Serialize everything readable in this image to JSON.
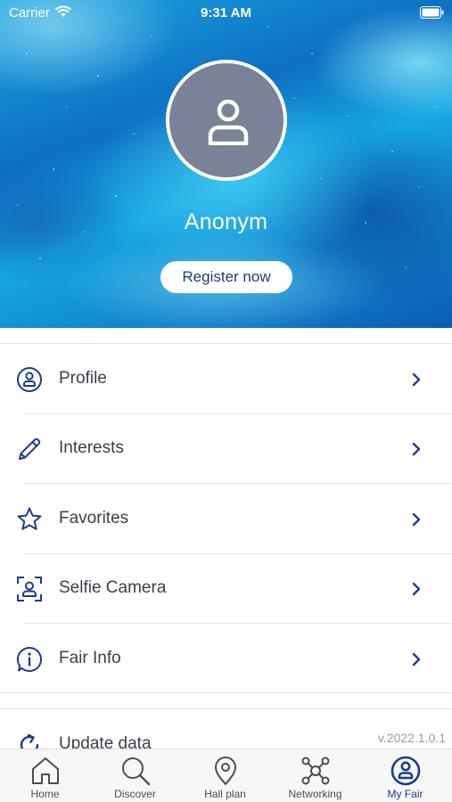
{
  "status_bar": {
    "carrier": "Carrier",
    "time": "9:31 AM"
  },
  "profile": {
    "name": "Anonym",
    "register_label": "Register now"
  },
  "menu": {
    "items": [
      {
        "label": "Profile",
        "icon": "user-circle-icon"
      },
      {
        "label": "Interests",
        "icon": "pencil-icon"
      },
      {
        "label": "Favorites",
        "icon": "star-icon"
      },
      {
        "label": "Selfie Camera",
        "icon": "selfie-camera-icon"
      },
      {
        "label": "Fair Info",
        "icon": "info-icon"
      }
    ],
    "update_label": "Update data",
    "version": "v.2022.1.0.1"
  },
  "tab_bar": {
    "tabs": [
      {
        "label": "Home",
        "icon": "home-icon"
      },
      {
        "label": "Discover",
        "icon": "search-icon"
      },
      {
        "label": "Hall plan",
        "icon": "map-pin-icon"
      },
      {
        "label": "Networking",
        "icon": "network-icon"
      },
      {
        "label": "My Fair",
        "icon": "user-circle-icon",
        "active": true
      }
    ]
  },
  "colors": {
    "accent": "#1d3c8a",
    "text": "#3b3f4a",
    "avatar_bg": "#7a8298",
    "tab_bar_bg": "#f7f7f8"
  }
}
